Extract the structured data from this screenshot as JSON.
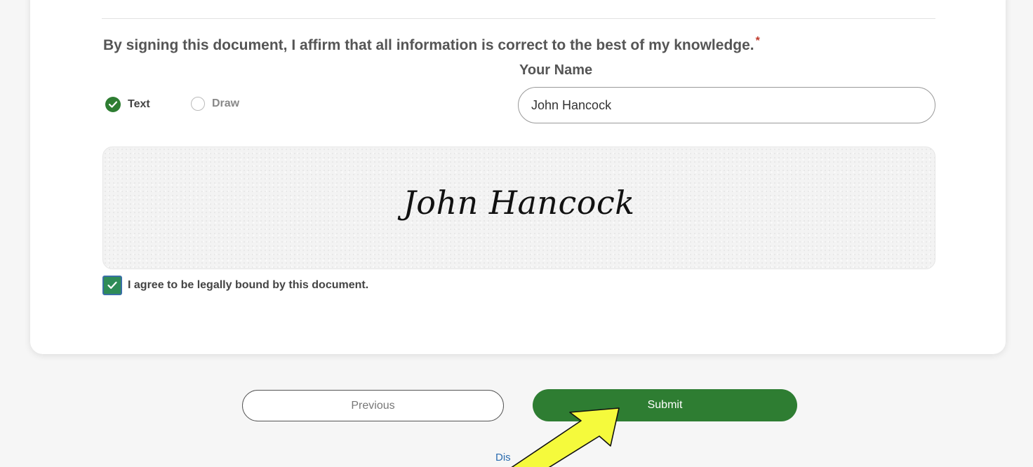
{
  "section": {
    "affirm_text": "By signing this document, I affirm that all information is correct to the best of my knowledge.",
    "required_marker": "*"
  },
  "signature": {
    "name_label": "Your Name",
    "name_value": "John Hancock",
    "modes": [
      {
        "label": "Text",
        "selected": true
      },
      {
        "label": "Draw",
        "selected": false
      }
    ],
    "rendered_signature": "John Hancock"
  },
  "agreement": {
    "label": "I agree to be legally bound by this document.",
    "checked": true
  },
  "buttons": {
    "previous_label": "Previous",
    "submit_label": "Submit"
  },
  "footer": {
    "partial_link_text": "Dis"
  },
  "colors": {
    "primary_green": "#2e7d32",
    "annotation_arrow": "#f5fa3c",
    "link_blue": "#2b6cb0"
  },
  "annotation": {
    "icon": "pointer-arrow-icon",
    "points_to": "submit-button"
  }
}
